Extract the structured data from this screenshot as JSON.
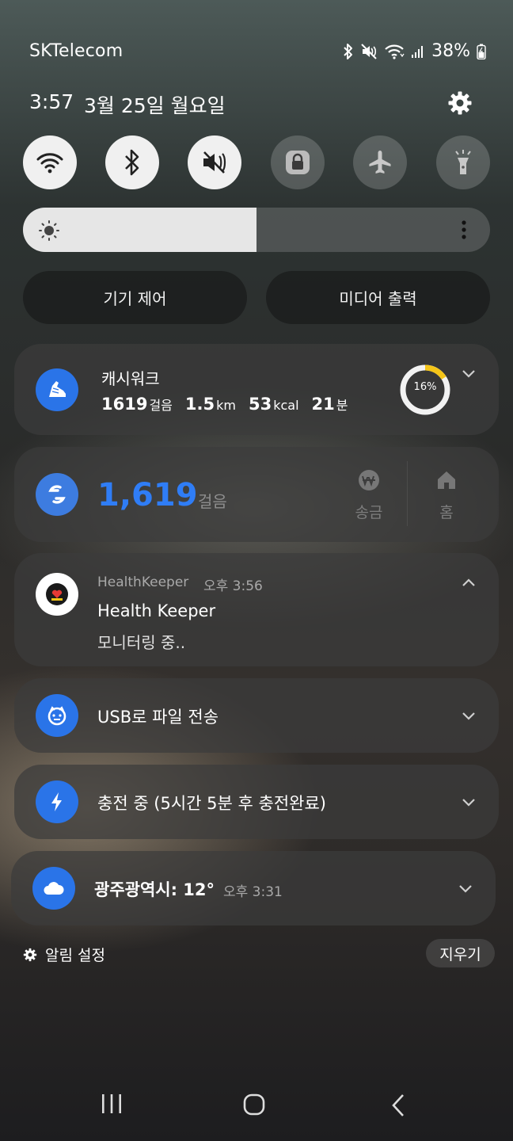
{
  "status_bar": {
    "carrier": "SKTelecom",
    "battery": "38%",
    "icons": [
      "bluetooth-icon",
      "vibrate-mute-icon",
      "wifi-icon",
      "signal-icon",
      "battery-icon"
    ]
  },
  "header": {
    "time": "3:57",
    "date": "3월 25일 월요일"
  },
  "quick_settings": [
    {
      "name": "wifi",
      "icon": "wifi-icon",
      "on": true
    },
    {
      "name": "bluetooth",
      "icon": "bluetooth-icon",
      "on": true
    },
    {
      "name": "sound",
      "icon": "mute-icon",
      "on": true
    },
    {
      "name": "rotation-lock",
      "icon": "lock-icon",
      "on": false
    },
    {
      "name": "airplane",
      "icon": "airplane-icon",
      "on": false
    },
    {
      "name": "flashlight",
      "icon": "flashlight-icon",
      "on": false
    }
  ],
  "brightness": {
    "level": 0.5
  },
  "buttons": {
    "device_control": "기기 제어",
    "media_output": "미디어 출력"
  },
  "cashwalk": {
    "app_name": "캐시워크",
    "steps_value": "1619",
    "steps_unit": "걸음",
    "distance_value": "1.5",
    "distance_unit": "km",
    "kcal_value": "53",
    "kcal_unit": "kcal",
    "minutes_value": "21",
    "minutes_unit": "분",
    "progress_label": "16%",
    "progress": 0.16,
    "ring_color": "#f5c518"
  },
  "step_widget": {
    "steps": "1,619",
    "unit": "걸음",
    "send_label": "송금",
    "home_label": "홈",
    "accent": "#2f7df6"
  },
  "healthkeeper": {
    "app_name": "HealthKeeper",
    "time": "오후 3:56",
    "title": "Health Keeper",
    "body": "모니터링 중.."
  },
  "usb": {
    "title": "USB로 파일 전송"
  },
  "charging": {
    "title": "충전 중 (5시간 5분 후 충전완료)"
  },
  "weather": {
    "title": "광주광역시: 12°",
    "time": "오후 3:31"
  },
  "footer": {
    "settings_label": "알림 설정",
    "clear_label": "지우기"
  }
}
